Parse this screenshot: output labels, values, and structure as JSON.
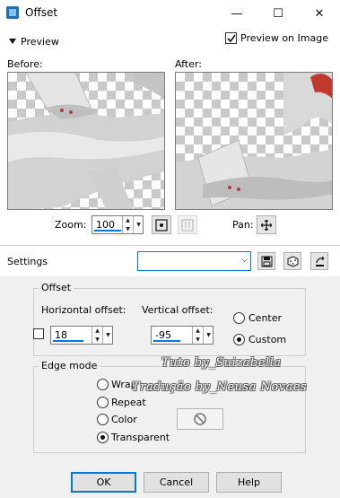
{
  "window": {
    "title": "Offset",
    "minimize": "—",
    "maximize": "☐",
    "close": "✕"
  },
  "preview": {
    "header_label": "Preview",
    "preview_on_image_label": "Preview on Image",
    "preview_on_image_checked": true,
    "before_label": "Before:",
    "after_label": "After:",
    "zoom_label": "Zoom:",
    "zoom_value": "100",
    "pan_label": "Pan:"
  },
  "settings": {
    "label": "Settings",
    "preset_value": ""
  },
  "offset": {
    "group_label": "Offset",
    "horizontal_label": "Horizontal offset:",
    "horizontal_value": "18",
    "vertical_label": "Vertical offset:",
    "vertical_value": "-95",
    "link_checked": false,
    "options": [
      "Center",
      "Custom"
    ],
    "selected": "Custom"
  },
  "edge_mode": {
    "group_label": "Edge mode",
    "options": [
      "Wrap",
      "Repeat",
      "Color",
      "Transparent"
    ],
    "selected": "Transparent"
  },
  "buttons": {
    "ok": "OK",
    "cancel": "Cancel",
    "help": "Help"
  },
  "watermark": {
    "line1": "Tuto by_Suizabella",
    "line2": "Tradução by_Neusa Novaes"
  },
  "icons": {
    "app": "psp-app-icon",
    "zoom_fit": "zoom-fit-icon",
    "zoom_actual": "zoom-actual-icon",
    "pan": "pan-move-icon",
    "save_preset": "save-preset-icon",
    "random": "randomize-icon",
    "reset": "reset-icon",
    "color_unavailable": "no-color-icon"
  },
  "colors": {
    "accent": "#0078d7",
    "app_icon": "#1f6fb2",
    "hair": "#c0392b"
  }
}
